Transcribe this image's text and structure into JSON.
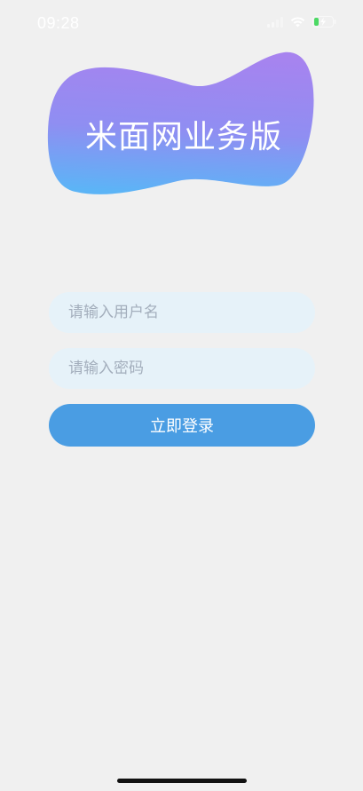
{
  "status_bar": {
    "time": "09:28",
    "icons": [
      "signal-icon",
      "wifi-icon",
      "battery-charging-icon"
    ]
  },
  "header": {
    "title": "米面网业务版",
    "blob_colors": {
      "top": "#a07cf0",
      "bottom": "#5eb3f5"
    }
  },
  "login_form": {
    "username_placeholder": "请输入用户名",
    "password_placeholder": "请输入密码",
    "login_button_label": "立即登录",
    "input_background": "#e6f2f9",
    "button_color": "#4a9de3"
  }
}
